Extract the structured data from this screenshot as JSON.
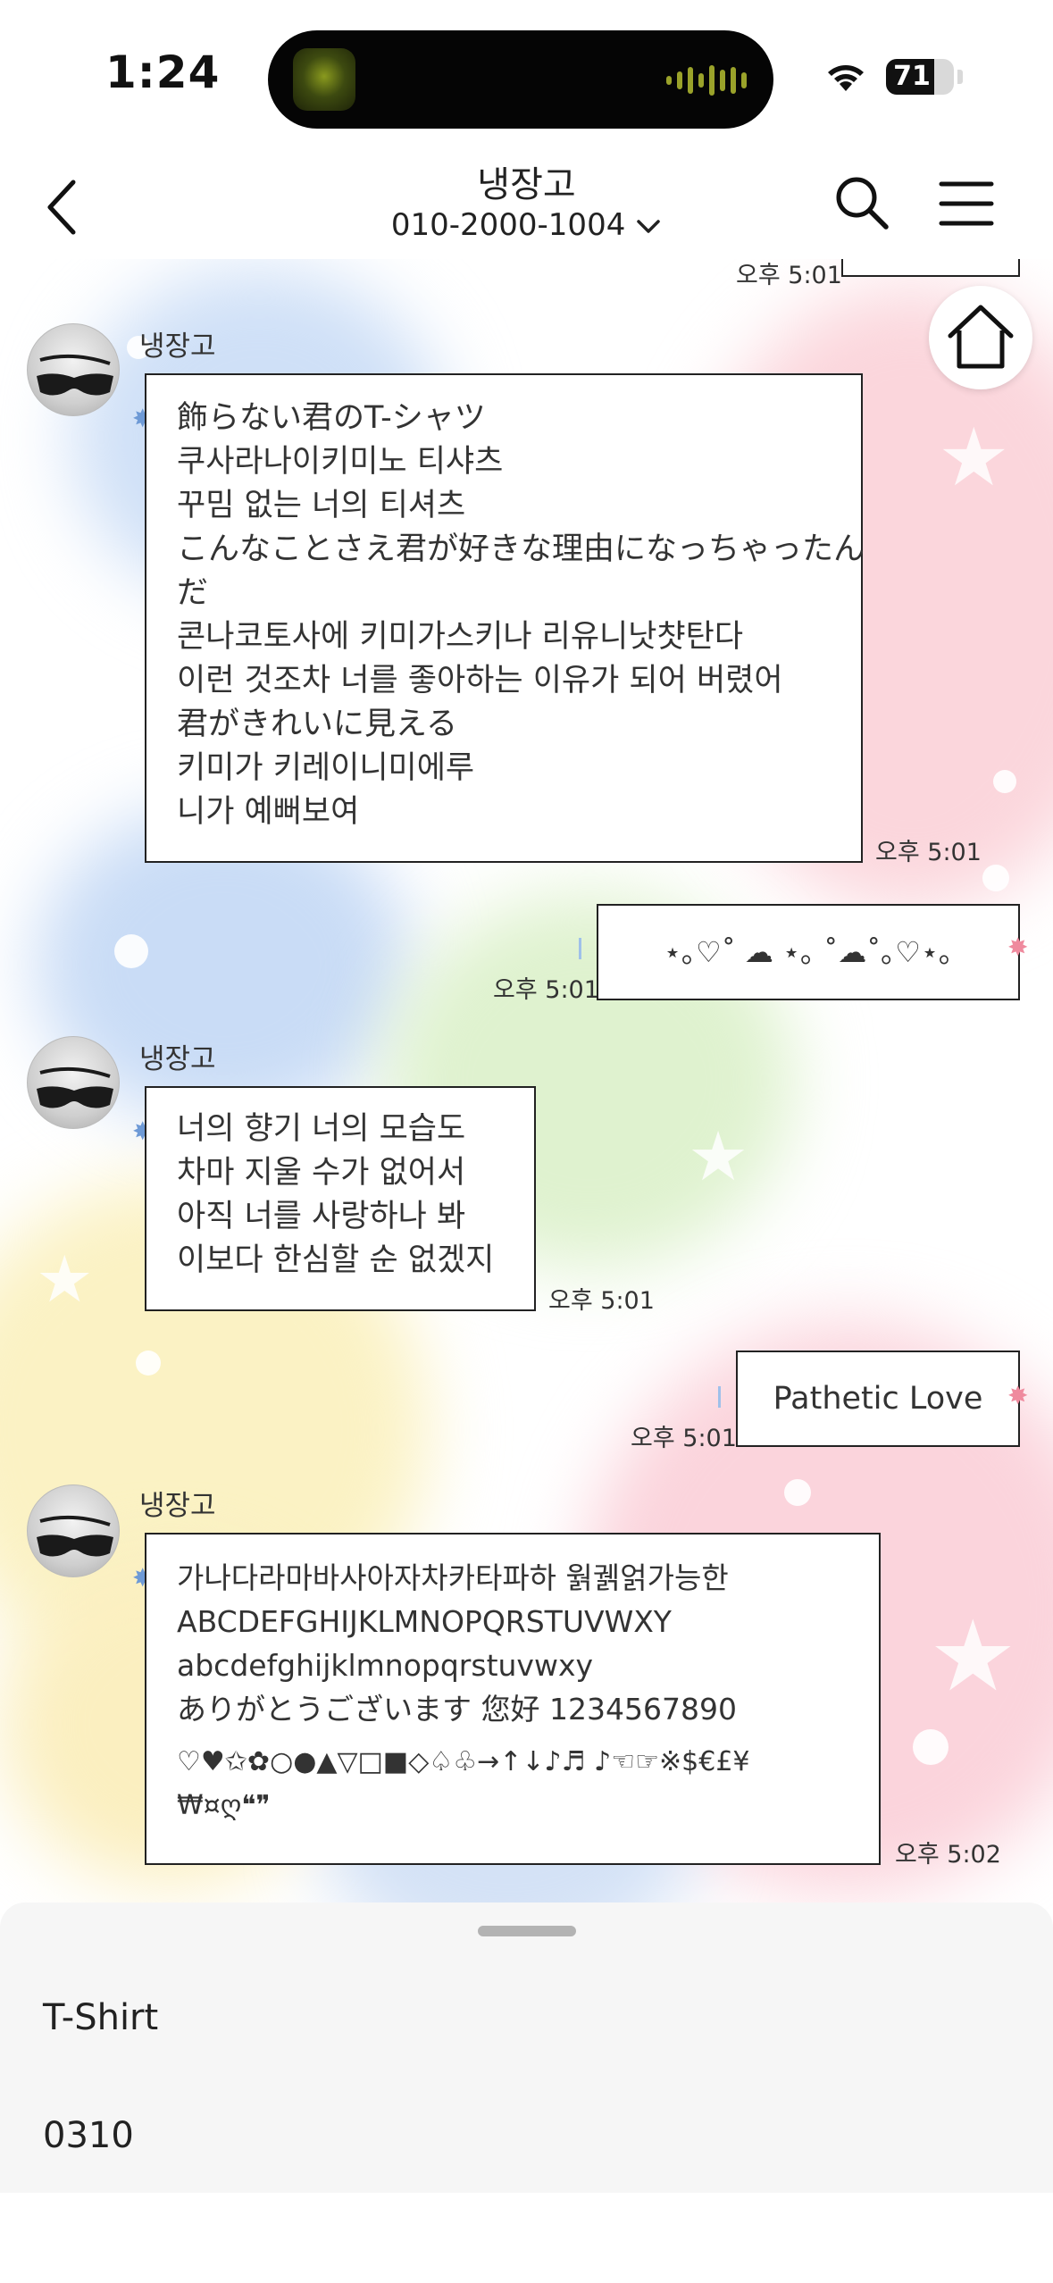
{
  "status_bar": {
    "time": "1:24",
    "battery": "71",
    "battery_level_percent": 71
  },
  "header": {
    "title": "냉장고",
    "subtitle": "010-2000-1004",
    "back_icon": "chevron-left-icon",
    "dropdown_icon": "chevron-down-icon",
    "search_icon": "search-icon",
    "menu_icon": "hamburger-menu-icon"
  },
  "chat": {
    "home_icon": "home-icon",
    "top_partial_timestamp": "오후 5:01",
    "messages": [
      {
        "sender": "냉장고",
        "lines": [
          "飾らない君のT-シャツ",
          "쿠사라나이키미노 티샤츠",
          "꾸밈 없는 너의 티셔츠",
          "こんなことさえ君が好きな理由になっちゃったん",
          "だ",
          "콘나코토사에 키미가스키나 리유니낫챳탄다",
          "이런 것조차 너를 좋아하는 이유가 되어 버렸어",
          "君がきれいに見える",
          "키미가 키레이니미에루",
          "니가 예뻐보여"
        ],
        "time": "오후 5:01"
      },
      {
        "mine": true,
        "lines": [
          "⋆｡♡˚ ☁︎ ⋆｡ ˚☁︎˚｡♡⋆｡"
        ],
        "time": "오후 5:01"
      },
      {
        "sender": "냉장고",
        "lines": [
          "너의 향기 너의 모습도",
          "차마 지울 수가 없어서",
          "아직 너를 사랑하나 봐",
          "이보다 한심할 순 없겠지"
        ],
        "time": "오후 5:01"
      },
      {
        "mine": true,
        "lines": [
          "Pathetic Love"
        ],
        "time": "오후 5:01"
      },
      {
        "sender": "냉장고",
        "lines": [
          "가나다라마바사아자차카타파하 웕궭얽가능한",
          "ABCDEFGHIJKLMNOPQRSTUVWXY",
          "abcdefghijklmnopqrstuvwxy",
          "ありがとうございます 您好 1234567890",
          "♡♥✩✿○●▲▽□■◇♤♧→↑↓♪♬ ♪☜☞※$€£¥",
          "₩¤ღ❝❞"
        ],
        "time": "오후 5:02"
      }
    ]
  },
  "bottom_sheet": {
    "items": [
      "T-Shirt",
      "0310"
    ]
  },
  "colors": {
    "bubble_border": "#222222",
    "left_tail": "#6e9ad6",
    "right_tail": "#ef8a9e",
    "sheet_bg": "#f6f6f6"
  }
}
